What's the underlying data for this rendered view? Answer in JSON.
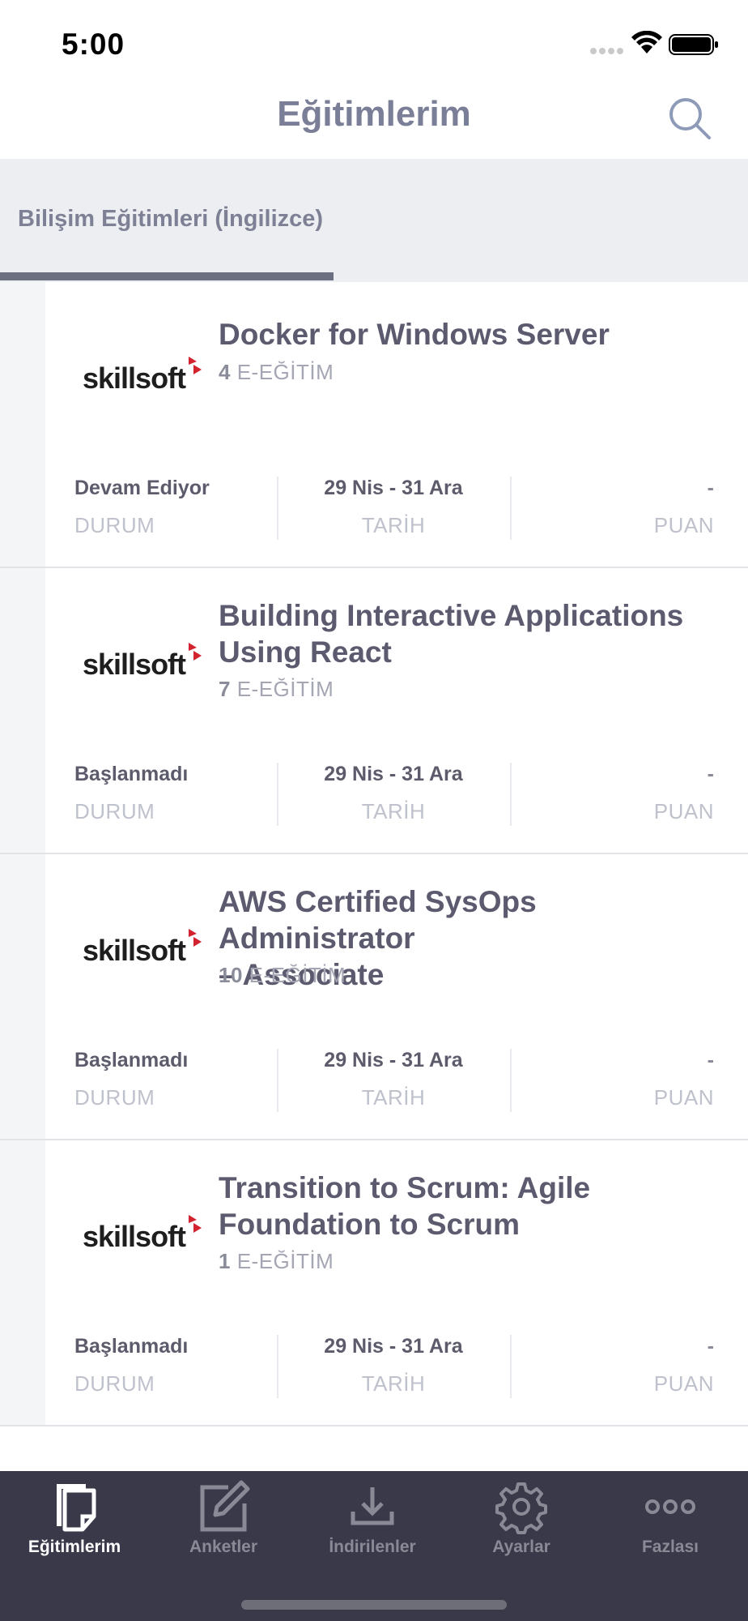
{
  "status_bar": {
    "time": "5:00"
  },
  "header": {
    "title": "Eğitimlerim"
  },
  "category_tab": {
    "label": "Bilişim Eğitimleri (İngilizce)"
  },
  "courses": [
    {
      "provider": "skillsoft",
      "title_lines": [
        "Docker for Windows Server"
      ],
      "count": "4",
      "count_unit": "E-EĞİTİM",
      "status_value": "Devam Ediyor",
      "status_label": "DURUM",
      "date_value": "29 Nis - 31 Ara",
      "date_label": "TARİH",
      "score_value": "-",
      "score_label": "PUAN"
    },
    {
      "provider": "skillsoft",
      "title_lines": [
        "Building Interactive Applications",
        "Using React"
      ],
      "count": "7",
      "count_unit": "E-EĞİTİM",
      "status_value": "Başlanmadı",
      "status_label": "DURUM",
      "date_value": "29 Nis - 31 Ara",
      "date_label": "TARİH",
      "score_value": "-",
      "score_label": "PUAN"
    },
    {
      "provider": "skillsoft",
      "title_lines": [
        "AWS Certified SysOps Administrator",
        "– Associate"
      ],
      "count": "10",
      "count_unit": "E-EĞİTİM",
      "status_value": "Başlanmadı",
      "status_label": "DURUM",
      "date_value": "29 Nis - 31 Ara",
      "date_label": "TARİH",
      "score_value": "-",
      "score_label": "PUAN"
    },
    {
      "provider": "skillsoft",
      "title_lines": [
        "Transition to Scrum: Agile",
        "Foundation to Scrum"
      ],
      "count": "1",
      "count_unit": "E-EĞİTİM",
      "status_value": "Başlanmadı",
      "status_label": "DURUM",
      "date_value": "29 Nis - 31 Ara",
      "date_label": "TARİH",
      "score_value": "-",
      "score_label": "PUAN"
    }
  ],
  "bottom_nav": [
    {
      "label": "Eğitimlerim",
      "icon": "courses-icon",
      "active": true
    },
    {
      "label": "Anketler",
      "icon": "survey-icon",
      "active": false
    },
    {
      "label": "İndirilenler",
      "icon": "download-icon",
      "active": false
    },
    {
      "label": "Ayarlar",
      "icon": "gear-icon",
      "active": false
    },
    {
      "label": "Fazlası",
      "icon": "more-icon",
      "active": false
    }
  ],
  "colors": {
    "title": "#7a7e96",
    "tab_bg": "#eceef1",
    "tab_indicator": "#6c6f80",
    "bottom_bar": "#3a3949",
    "logo_accent": "#d3232f"
  }
}
